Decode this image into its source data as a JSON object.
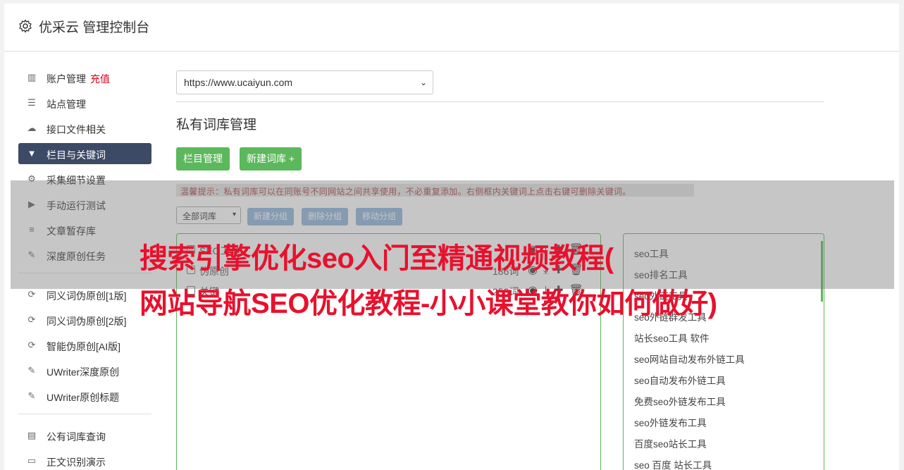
{
  "header": {
    "title": "优采云 管理控制台"
  },
  "sidebar": {
    "group1": [
      {
        "label": "账户管理",
        "extra": "充值",
        "icon": "bar-chart-icon"
      },
      {
        "label": "站点管理",
        "icon": "server-icon"
      },
      {
        "label": "接口文件相关",
        "icon": "cloud-upload-icon"
      },
      {
        "label": "栏目与关键词",
        "icon": "filter-icon",
        "active": true
      },
      {
        "label": "采集细节设置",
        "icon": "cogs-icon"
      },
      {
        "label": "手动运行测试",
        "icon": "play-circle-icon"
      },
      {
        "label": "文章暂存库",
        "icon": "database-icon"
      },
      {
        "label": "深度原创任务",
        "icon": "edit-icon"
      }
    ],
    "group2": [
      {
        "label": "同义词伪原创[1版]",
        "icon": "refresh-icon"
      },
      {
        "label": "同义词伪原创[2版]",
        "icon": "refresh-icon"
      },
      {
        "label": "智能伪原创[AI版]",
        "icon": "refresh-icon"
      },
      {
        "label": "UWriter深度原创",
        "icon": "edit-icon"
      },
      {
        "label": "UWriter原创标题",
        "icon": "edit-icon"
      }
    ],
    "group3": [
      {
        "label": "公有词库查询",
        "icon": "book-icon"
      },
      {
        "label": "正文识别演示",
        "icon": "monitor-icon"
      }
    ]
  },
  "site_select": {
    "value": "https://www.ucaiyun.com"
  },
  "section": {
    "title": "私有词库管理"
  },
  "buttons": {
    "column_manage": "栏目管理",
    "new_lib": "新建词库 +"
  },
  "hint": "温馨提示：私有词库可以在同账号不同网站之间共享使用，不必重复添加。右侧框内关键词上点击右键可删除关键词。",
  "group_select": {
    "value": "全部词库"
  },
  "group_buttons": {
    "new_group": "新建分组",
    "delete_group": "删除分组",
    "move_group": "移动分组"
  },
  "libraries": [
    {
      "name": "SEO工具",
      "count": ""
    },
    {
      "name": "伪原创",
      "count": "186词"
    },
    {
      "name": "关键",
      "count": "259词"
    }
  ],
  "keywords": [
    "seo工具",
    "seo排名工具",
    "seo外链工具",
    "seo外链群发工具",
    "站长seo工具 软件",
    "seo网站自动发布外链工具",
    "seo自动发布外链工具",
    "免费seo外链发布工具",
    "seo外链发布工具",
    "百度seo站长工具",
    "seo 百度 站长工具"
  ],
  "overlay": {
    "line1": "搜索引擎优化seo入门至精通视频教程(",
    "line2": "网站导航SEO优化教程-小小课堂教你如何做好)"
  }
}
